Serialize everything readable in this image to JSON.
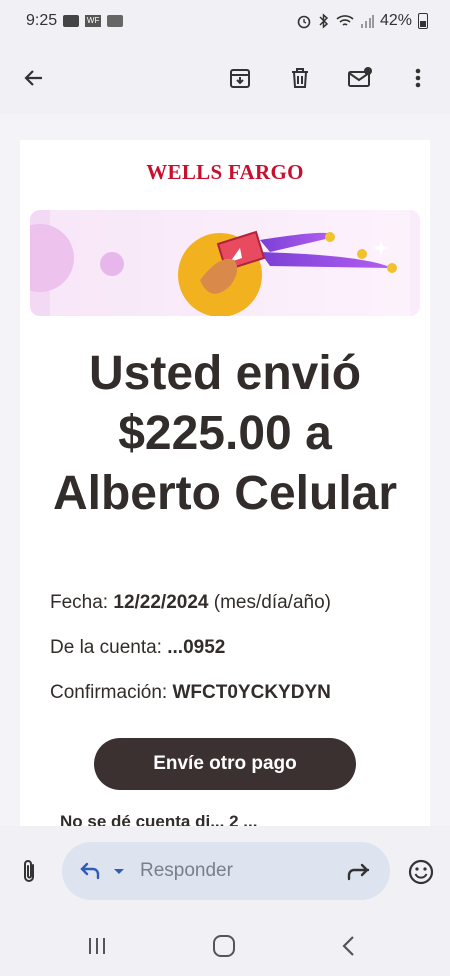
{
  "status_bar": {
    "time": "9:25",
    "wf_badge": "WF",
    "battery": "42%"
  },
  "toolbar": {
    "back_icon": "arrow-back-icon",
    "archive_icon": "archive-icon",
    "delete_icon": "trash-icon",
    "unread_icon": "mark-unread-icon",
    "more_icon": "more-vert-icon"
  },
  "email": {
    "brand": "WELLS FARGO",
    "headline": [
      "Usted envió",
      "$225.00 a",
      "Alberto Celular"
    ],
    "fecha_label": "Fecha:",
    "fecha_value": "12/22/2024",
    "fecha_suffix": "(mes/día/año)",
    "cuenta_label": "De la cuenta:",
    "cuenta_value": "...0952",
    "confirm_label": "Confirmación:",
    "confirm_value": "WFCT0YCKYDYN",
    "cta_label": "Envíe otro pago",
    "cutoff_text": "No se dé cuenta di... 2 ..."
  },
  "reply_bar": {
    "placeholder": "Responder",
    "attach_icon": "paperclip-icon",
    "reply_icon": "reply-icon",
    "forward_icon": "forward-icon",
    "emoji_icon": "emoji-icon"
  },
  "colors": {
    "brand_red": "#c8102e",
    "cta_bg": "#3b3130",
    "chrome_bg": "#f1f1f5",
    "pill_bg": "#dde3ef"
  }
}
